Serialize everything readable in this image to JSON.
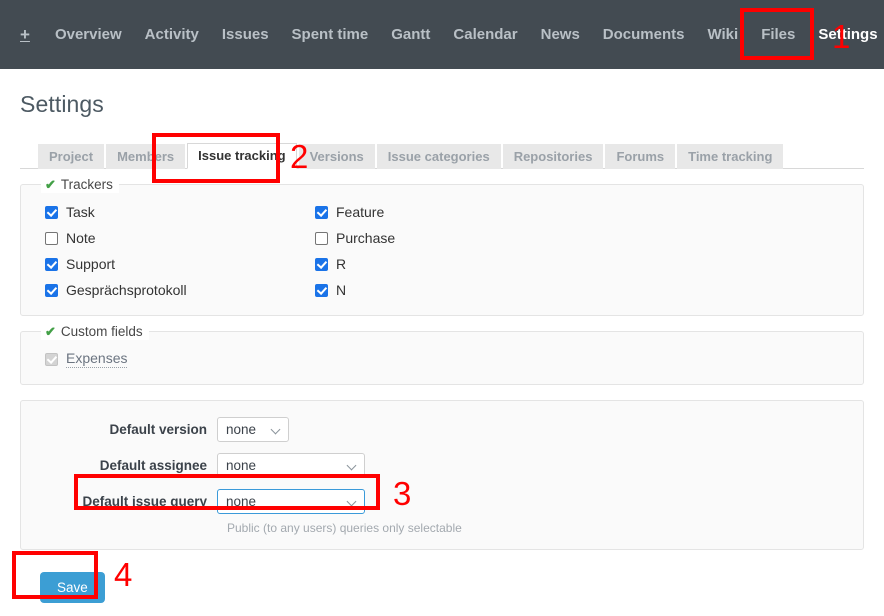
{
  "topnav": {
    "add_label": "+",
    "items": [
      {
        "label": "Overview",
        "current": false
      },
      {
        "label": "Activity",
        "current": false
      },
      {
        "label": "Issues",
        "current": false
      },
      {
        "label": "Spent time",
        "current": false
      },
      {
        "label": "Gantt",
        "current": false
      },
      {
        "label": "Calendar",
        "current": false
      },
      {
        "label": "News",
        "current": false
      },
      {
        "label": "Documents",
        "current": false
      },
      {
        "label": "Wiki",
        "current": false
      },
      {
        "label": "Files",
        "current": false
      },
      {
        "label": "Settings",
        "current": true
      }
    ]
  },
  "page": {
    "title": "Settings"
  },
  "tabs": [
    {
      "label": "Project",
      "selected": false
    },
    {
      "label": "Members",
      "selected": false
    },
    {
      "label": "Issue tracking",
      "selected": true
    },
    {
      "label": "Versions",
      "selected": false
    },
    {
      "label": "Issue categories",
      "selected": false
    },
    {
      "label": "Repositories",
      "selected": false
    },
    {
      "label": "Forums",
      "selected": false
    },
    {
      "label": "Time tracking",
      "selected": false
    }
  ],
  "trackers": {
    "legend": "Trackers",
    "columns": [
      [
        {
          "label": "Task",
          "checked": true,
          "disabled": false
        },
        {
          "label": "Note",
          "checked": false,
          "disabled": false
        }
      ],
      [
        {
          "label": "Feature",
          "checked": true,
          "disabled": false
        },
        {
          "label": "Purchase",
          "checked": false,
          "disabled": false
        }
      ],
      [
        {
          "label": "Support",
          "checked": true,
          "disabled": false
        },
        {
          "label": "Gesprächsprotokoll",
          "checked": true,
          "disabled": false
        }
      ],
      [
        {
          "label": "R",
          "checked": true,
          "disabled": false
        },
        {
          "label": "N",
          "checked": true,
          "disabled": false
        }
      ]
    ]
  },
  "custom_fields": {
    "legend": "Custom fields",
    "items": [
      {
        "label": "Expenses",
        "checked": true,
        "disabled": true
      }
    ]
  },
  "defaults": {
    "version": {
      "label": "Default version",
      "value": "none"
    },
    "assignee": {
      "label": "Default assignee",
      "value": "none"
    },
    "issue_query": {
      "label": "Default issue query",
      "value": "none",
      "hint": "Public (to any users) queries only selectable"
    }
  },
  "actions": {
    "save_label": "Save"
  },
  "annotations": [
    {
      "number": "1"
    },
    {
      "number": "2"
    },
    {
      "number": "3"
    },
    {
      "number": "4"
    }
  ],
  "colors": {
    "nav_background": "#434b52",
    "annotation": "#ff0000",
    "accent": "#3c9ed4",
    "checkbox_checked": "#1a73e8",
    "legend_check": "#43a047"
  }
}
